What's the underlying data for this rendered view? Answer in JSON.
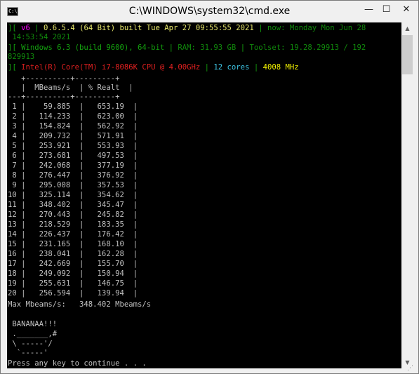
{
  "window": {
    "title": "C:\\WINDOWS\\system32\\cmd.exe",
    "icon_text": "C:\\",
    "minimize": "—",
    "maximize": "☐",
    "close": "✕"
  },
  "header": {
    "l1_bracket": "][",
    "l1_v": " v6 ",
    "l1_sep": "|",
    "l1_build": " 0.6.5.4 (64 Bit) built Tue Apr 27 09:55:55 2021 ",
    "l1_now": " now: Monday Mon Jun 28",
    "l2": " 14:53:54 2021",
    "l3_bracket": "][",
    "l3_win": " Windows 6.3 (build 9600), 64-bit ",
    "l3_ram": " RAM: 31.93 GB ",
    "l3_tool": " Toolset: 19.28.29913 / 192",
    "l4": "829913",
    "l5_bracket": "][",
    "l5_cpu": " Intel(R) Core(TM) i7-8086K CPU @ 4.00GHz ",
    "l5_cores": " 12 cores ",
    "l5_mhz": " 4008 MHz"
  },
  "table": {
    "border_top": "   +----------+---------+",
    "header": "   |  MBeams/s  | % Realt  |",
    "border_mid": "---+----------+---------+",
    "rows": [
      " 1 |    59.885  |   653.19  |",
      " 2 |   114.233  |   623.00  |",
      " 3 |   154.824  |   562.92  |",
      " 4 |   209.732  |   571.91  |",
      " 5 |   253.921  |   553.93  |",
      " 6 |   273.681  |   497.53  |",
      " 7 |   242.068  |   377.19  |",
      " 8 |   276.447  |   376.92  |",
      " 9 |   295.008  |   357.53  |",
      "10 |   325.114  |   354.62  |",
      "11 |   348.402  |   345.47  |",
      "12 |   270.443  |   245.82  |",
      "13 |   218.529  |   183.35  |",
      "14 |   226.437  |   176.42  |",
      "15 |   231.165  |   168.10  |",
      "16 |   238.041  |   162.28  |",
      "17 |   242.669  |   155.70  |",
      "18 |   249.092  |   150.94  |",
      "19 |   255.631  |   146.75  |",
      "20 |   256.594  |   139.94  |"
    ]
  },
  "footer": {
    "max": "Max Mbeams/s:   348.402 Mbeams/s",
    "blank": "",
    "banana": " BANANAA!!!",
    "art1": " ._______,#",
    "art2": " \\ -----'/",
    "art3": "  `-----'",
    "blank2": "",
    "prompt": "Press any key to continue . . ."
  },
  "scrollbar": {
    "up": "▲",
    "down": "▼"
  },
  "resize_grip": "⋰"
}
